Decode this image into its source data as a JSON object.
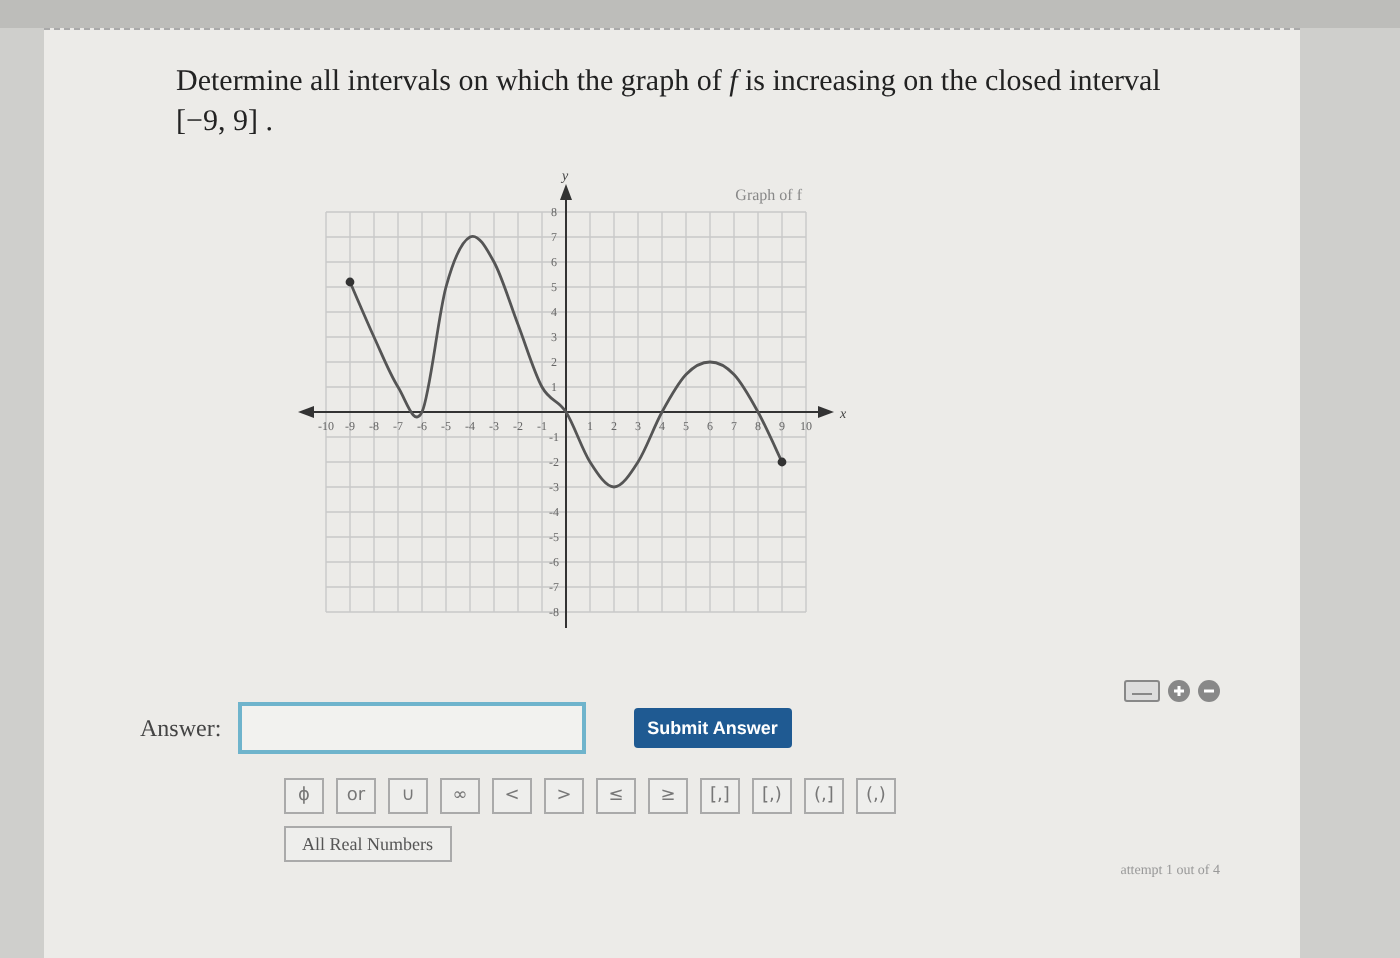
{
  "question": "Determine all intervals on which the graph of *f* is increasing on the closed interval [−9, 9] .",
  "graph": {
    "chart_data": {
      "type": "line",
      "title": "Graph of f",
      "xlabel": "x",
      "ylabel": "y",
      "x": [
        -9,
        -8,
        -7,
        -6,
        -5,
        -4,
        -3,
        -2,
        -1,
        0,
        1,
        2,
        3,
        4,
        5,
        6,
        7,
        8,
        9
      ],
      "grid": true,
      "series": [
        {
          "color": "#555555",
          "values": [
            5.2,
            3,
            1,
            0,
            5,
            7,
            6,
            3.5,
            1,
            0,
            -2,
            -3,
            -2,
            0,
            1.5,
            2,
            1.5,
            0,
            -2
          ]
        }
      ],
      "xlim": [
        -10,
        10
      ],
      "ylim": [
        -8,
        8
      ],
      "xticks": [
        -10,
        -9,
        -8,
        -7,
        -6,
        -5,
        -4,
        -3,
        -2,
        -1,
        1,
        2,
        3,
        4,
        5,
        6,
        7,
        8,
        9,
        10
      ],
      "yticks": [
        -8,
        -7,
        -6,
        -5,
        -4,
        -3,
        -2,
        -1,
        1,
        2,
        3,
        4,
        5,
        6,
        7,
        8
      ]
    }
  },
  "answer": {
    "label": "Answer:",
    "submit": "Submit Answer"
  },
  "symbols": [
    "ϕ",
    "or",
    "∪",
    "∞",
    "<",
    ">",
    "≤",
    "≥",
    "[,]",
    "[,)",
    "(,]",
    "(,)"
  ],
  "all_real": "All Real Numbers",
  "attempt": "attempt 1 out of 4"
}
